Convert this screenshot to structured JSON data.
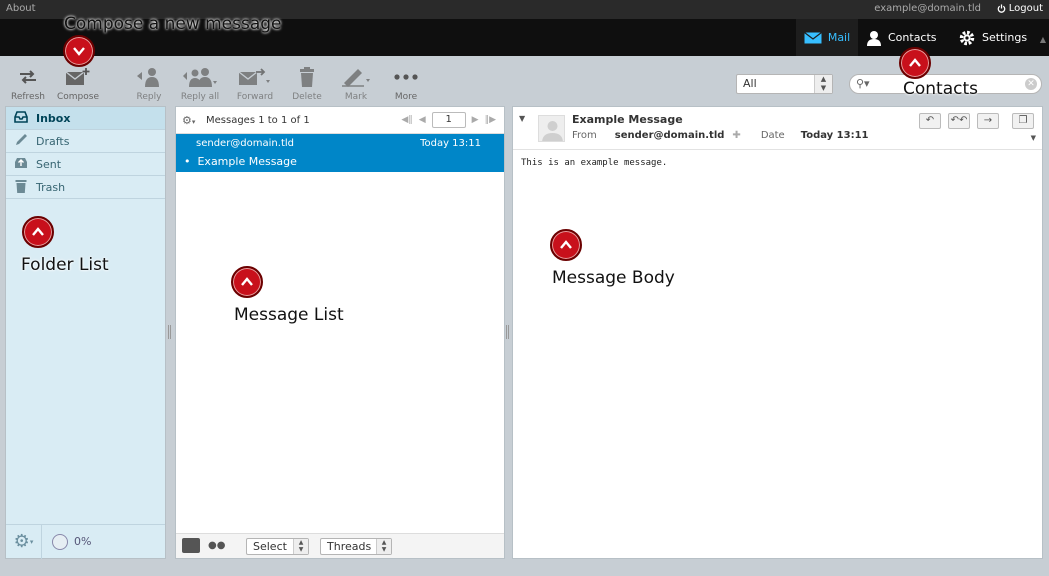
{
  "topline": {
    "about": "About",
    "user": "example@domain.tld",
    "logout": "Logout"
  },
  "tasks": {
    "mail": "Mail",
    "contacts": "Contacts",
    "settings": "Settings"
  },
  "toolbar": {
    "refresh": "Refresh",
    "compose": "Compose",
    "reply": "Reply",
    "reply_all": "Reply all",
    "forward": "Forward",
    "delete": "Delete",
    "mark": "Mark",
    "more": "More",
    "filter_value": "All"
  },
  "folders": [
    {
      "label": "Inbox",
      "icon": "inbox-icon"
    },
    {
      "label": "Drafts",
      "icon": "pencil-icon"
    },
    {
      "label": "Sent",
      "icon": "sent-icon"
    },
    {
      "label": "Trash",
      "icon": "trash-icon"
    }
  ],
  "quota": "0%",
  "messagelist": {
    "count": "Messages 1 to 1 of 1",
    "page": "1",
    "rows": [
      {
        "from": "sender@domain.tld",
        "date": "Today 13:11",
        "subject": "Example Message"
      }
    ],
    "select_label": "Select",
    "threads_label": "Threads"
  },
  "message": {
    "subject": "Example Message",
    "from_label": "From",
    "from": "sender@domain.tld",
    "date_label": "Date",
    "date": "Today 13:11",
    "body": "This is an example message."
  },
  "annotations": {
    "compose": "Compose a new message",
    "contacts": "Contacts",
    "folder_list": "Folder List",
    "message_list": "Message List",
    "message_body": "Message Body"
  },
  "colors": {
    "accent": "#0086c8",
    "annotation": "#c8101b",
    "mail_active": "#37beff"
  }
}
